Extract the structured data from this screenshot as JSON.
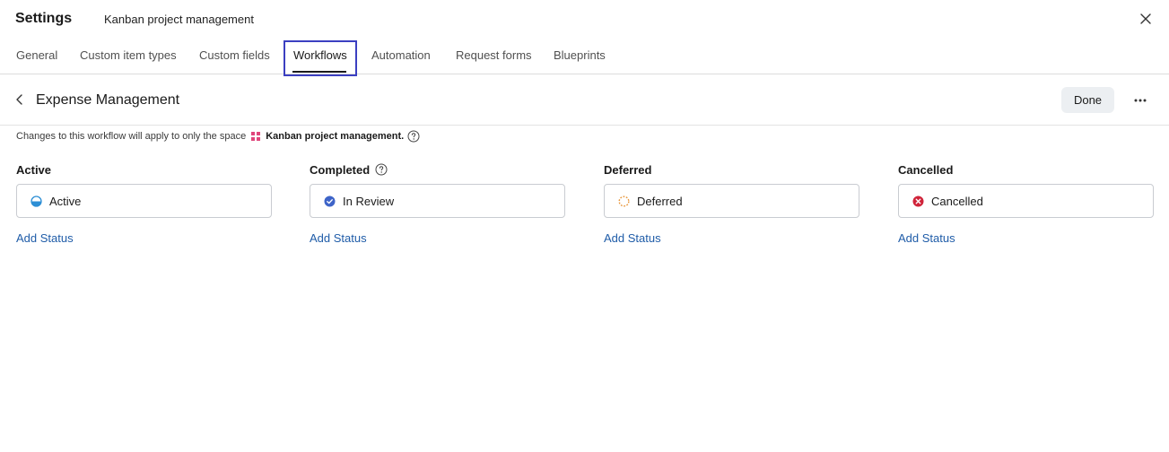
{
  "header": {
    "title": "Settings",
    "project": "Kanban project management",
    "close_icon": "close-icon"
  },
  "tabs": [
    {
      "label": "General"
    },
    {
      "label": "Custom item types"
    },
    {
      "label": "Custom fields"
    },
    {
      "label": "Workflows",
      "active": true
    },
    {
      "label": "Automation"
    },
    {
      "label": "Request forms"
    },
    {
      "label": "Blueprints"
    }
  ],
  "workflow": {
    "title": "Expense Management",
    "done_label": "Done",
    "more_icon": "more-horizontal-icon",
    "back_icon": "chevron-left-icon"
  },
  "notice": {
    "prefix": "Changes to this workflow will apply to only the space",
    "space_name": "Kanban project management.",
    "space_icon_color": "#e0457b"
  },
  "columns": [
    {
      "header": "Active",
      "status": "Active",
      "add": "Add Status",
      "icon": "half-circle-icon",
      "color": "#2d8fd5"
    },
    {
      "header": "Completed",
      "status": "In Review",
      "add": "Add Status",
      "icon": "check-circle-icon",
      "color": "#3e64c8",
      "help": true
    },
    {
      "header": "Deferred",
      "status": "Deferred",
      "add": "Add Status",
      "icon": "dashed-circle-icon",
      "color": "#e8963a"
    },
    {
      "header": "Cancelled",
      "status": "Cancelled",
      "add": "Add Status",
      "icon": "x-circle-icon",
      "color": "#d0243a"
    }
  ],
  "colors": {
    "accent": "#3b3fc1",
    "link": "#1f5ca8",
    "done_bg": "#eceff2"
  }
}
